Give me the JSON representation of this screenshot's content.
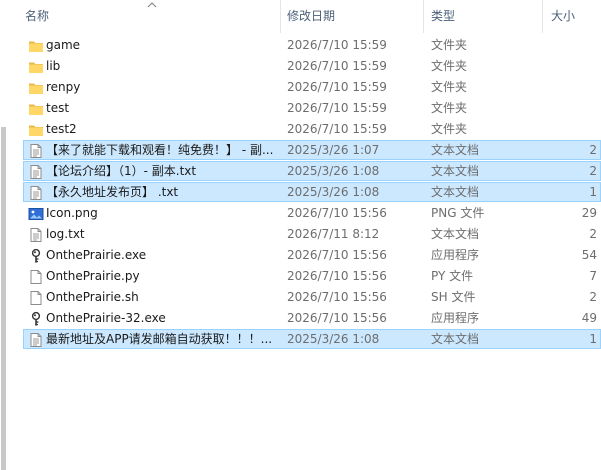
{
  "columns": {
    "name": "名称",
    "date": "修改日期",
    "type": "类型",
    "size": "大小"
  },
  "files": [
    {
      "name": "game",
      "date": "2026/7/10 15:59",
      "type": "文件夹",
      "size": "",
      "icon": "folder-icon",
      "selected": false
    },
    {
      "name": "lib",
      "date": "2026/7/10 15:59",
      "type": "文件夹",
      "size": "",
      "icon": "folder-icon",
      "selected": false
    },
    {
      "name": "renpy",
      "date": "2026/7/10 15:59",
      "type": "文件夹",
      "size": "",
      "icon": "folder-icon",
      "selected": false
    },
    {
      "name": "test",
      "date": "2026/7/10 15:59",
      "type": "文件夹",
      "size": "",
      "icon": "folder-icon",
      "selected": false
    },
    {
      "name": "test2",
      "date": "2026/7/10 15:59",
      "type": "文件夹",
      "size": "",
      "icon": "folder-icon",
      "selected": false
    },
    {
      "name": "【来了就能下载和观看！纯免费！】 - 副...",
      "date": "2025/3/26 1:07",
      "type": "文本文档",
      "size": "2",
      "icon": "text-file-icon",
      "selected": true
    },
    {
      "name": "【论坛介绍】（1）- 副本.txt",
      "date": "2025/3/26 1:08",
      "type": "文本文档",
      "size": "2",
      "icon": "text-file-icon",
      "selected": true
    },
    {
      "name": "【永久地址发布页】 .txt",
      "date": "2025/3/26 1:08",
      "type": "文本文档",
      "size": "1",
      "icon": "text-file-icon",
      "selected": true
    },
    {
      "name": "Icon.png",
      "date": "2026/7/10 15:56",
      "type": "PNG 文件",
      "size": "29",
      "icon": "image-file-icon",
      "selected": false
    },
    {
      "name": "log.txt",
      "date": "2026/7/11 8:12",
      "type": "文本文档",
      "size": "2",
      "icon": "text-file-icon",
      "selected": false
    },
    {
      "name": "OnthePrairie.exe",
      "date": "2026/7/10 15:56",
      "type": "应用程序",
      "size": "54",
      "icon": "exe-app-icon",
      "selected": false
    },
    {
      "name": "OnthePrairie.py",
      "date": "2026/7/10 15:56",
      "type": "PY 文件",
      "size": "7",
      "icon": "blank-file-icon",
      "selected": false
    },
    {
      "name": "OnthePrairie.sh",
      "date": "2026/7/10 15:56",
      "type": "SH 文件",
      "size": "2",
      "icon": "blank-file-icon",
      "selected": false
    },
    {
      "name": "OnthePrairie-32.exe",
      "date": "2026/7/10 15:56",
      "type": "应用程序",
      "size": "49",
      "icon": "exe-app-icon",
      "selected": false
    },
    {
      "name": "最新地址及APP请发邮箱自动获取！！！...",
      "date": "2025/3/26 1:08",
      "type": "文本文档",
      "size": "1",
      "icon": "text-file-icon",
      "selected": true
    }
  ],
  "colors": {
    "selection_bg": "#cce8ff",
    "selection_border": "#99d1ff",
    "folder": "#ffd766",
    "header_text": "#4c607a"
  }
}
